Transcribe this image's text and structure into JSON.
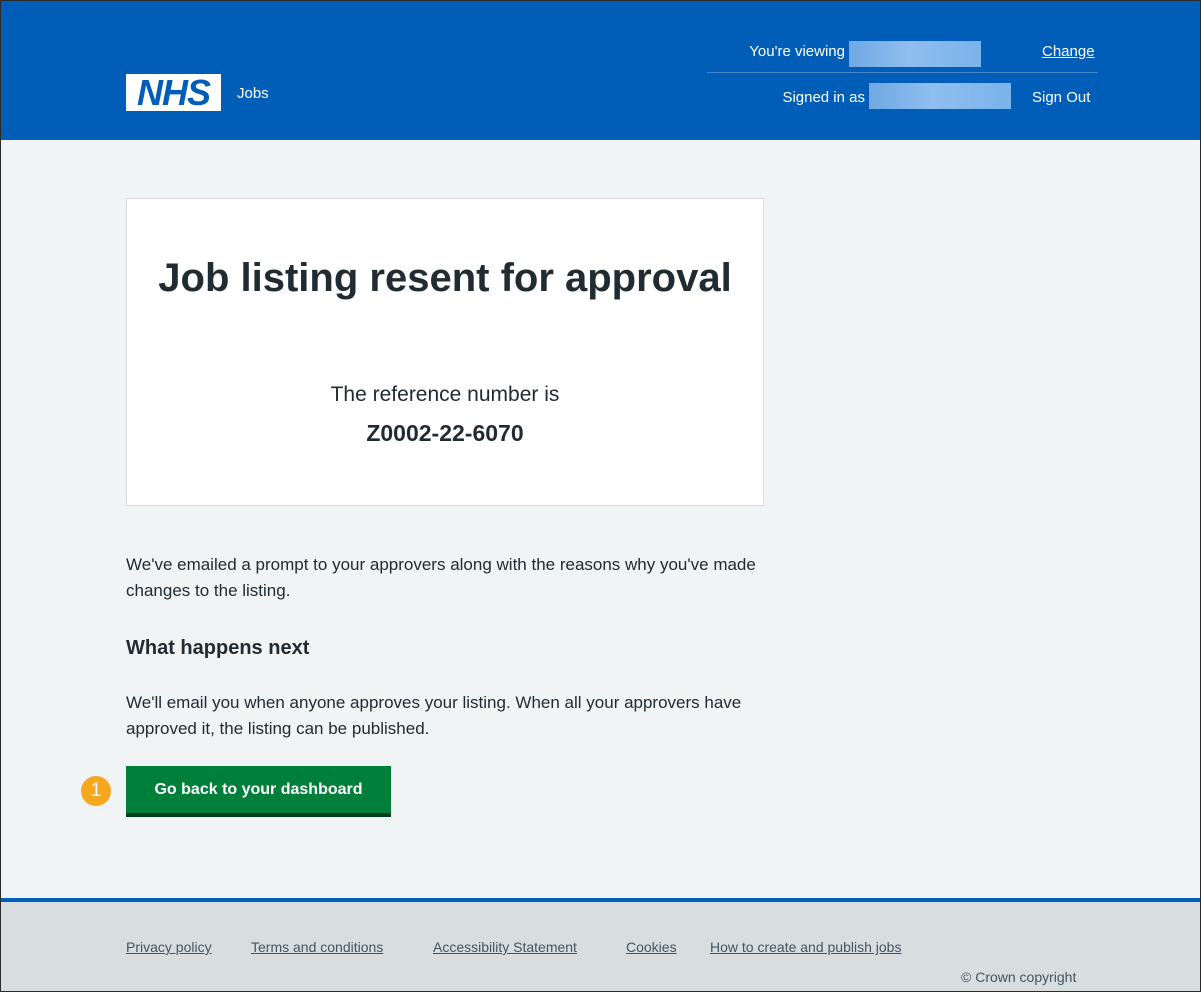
{
  "header": {
    "logo_text": "NHS",
    "service_name": "Jobs",
    "viewing_label": "You're viewing",
    "change_link": "Change",
    "signed_in_label": "Signed in as",
    "sign_out_link": "Sign Out",
    "brand_color": "#005eb8"
  },
  "panel": {
    "title": "Job listing resent for approval",
    "reference_label": "The reference number is",
    "reference_number": "Z0002-22-6070"
  },
  "main": {
    "intro_text": "We've emailed a prompt to your approvers along with the reasons why you've made changes to the listing.",
    "next_heading": "What happens next",
    "next_text": "We'll email you when anyone approves your listing. When all your approvers have approved it, the listing can be published.",
    "dashboard_button": "Go back to your dashboard",
    "step_badge": "1"
  },
  "footer": {
    "links": [
      "Privacy policy",
      "Terms and conditions",
      "Accessibility Statement",
      "Cookies",
      "How to create and publish jobs"
    ],
    "copyright": "© Crown copyright"
  }
}
